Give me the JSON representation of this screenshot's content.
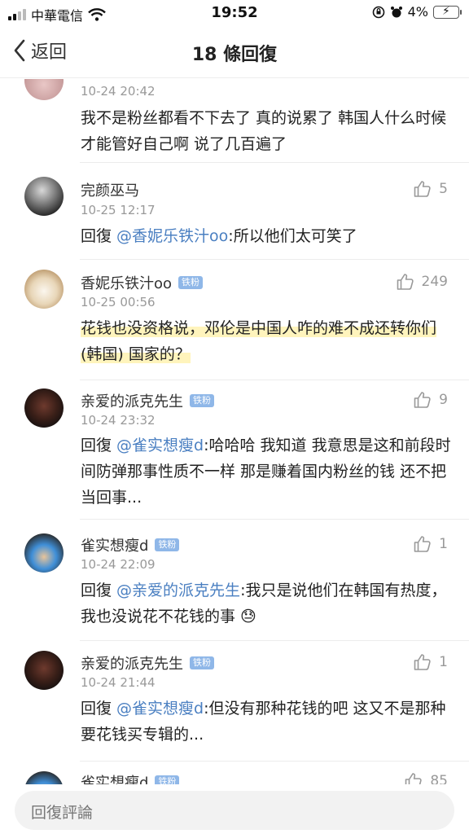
{
  "status_bar": {
    "carrier": "中華電信",
    "time": "19:52",
    "battery": "4%"
  },
  "nav": {
    "back_label": "返回",
    "title": "18 條回復"
  },
  "comments": [
    {
      "name": "",
      "time": "10-24 20:42",
      "text": "我不是粉丝都看不下去了 真的说累了 韩国人什么时候才能管好自己啊 说了几百遍了"
    },
    {
      "name": "完颜巫马",
      "time": "10-25 12:17",
      "likes": "5",
      "reply_prefix": "回復 ",
      "mention": "@香妮乐铁汁oo",
      "text": ":所以他们太可笑了"
    },
    {
      "name": "香妮乐铁汁oo",
      "badge": "铁粉",
      "time": "10-25 00:56",
      "likes": "249",
      "text": "花钱也没资格说，邓伦是中国人咋的难不成还转你们 (韩国) 国家的？"
    },
    {
      "name": "亲爱的派克先生",
      "badge": "铁粉",
      "time": "10-24 23:32",
      "likes": "9",
      "reply_prefix": "回復 ",
      "mention": "@雀实想瘦d",
      "text": ":哈哈哈 我知道 我意思是这和前段时间防弹那事性质不一样 那是赚着国内粉丝的钱 还不把当回事..."
    },
    {
      "name": "雀实想瘦d",
      "badge": "铁粉",
      "time": "10-24 22:09",
      "likes": "1",
      "reply_prefix": "回復 ",
      "mention": "@亲爱的派克先生",
      "text": ":我只是说他们在韩国有热度，我也没说花不花钱的事 😓"
    },
    {
      "name": "亲爱的派克先生",
      "badge": "铁粉",
      "time": "10-24 21:44",
      "likes": "1",
      "reply_prefix": "回復 ",
      "mention": "@雀实想瘦d",
      "text": ":但没有那种花钱的吧 这又不是那种要花钱买专辑的..."
    },
    {
      "name": "雀实想瘦d",
      "badge": "铁粉",
      "likes": "85"
    }
  ],
  "input": {
    "placeholder": "回復評論"
  },
  "colors": {
    "mention": "#4a7fc1",
    "badge": "#8fb7e8",
    "highlight": "#fff3b9"
  }
}
